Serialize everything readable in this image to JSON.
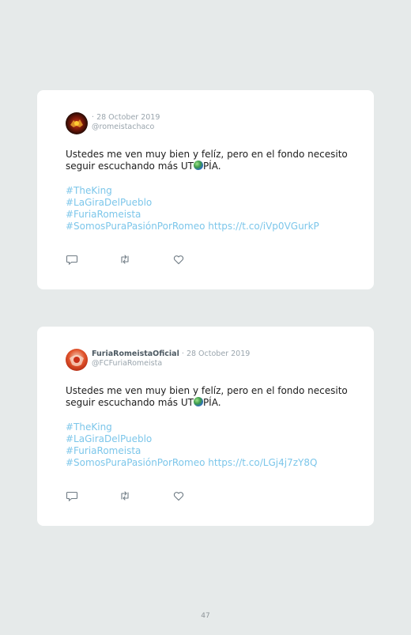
{
  "tweets": [
    {
      "display_name": "",
      "separator": "·",
      "date": "28 October 2019",
      "handle": "@romeistachaco",
      "text_line1": "Ustedes me ven muy bien y felíz, pero en el fondo necesito",
      "text_line2_a": "seguir escuchando más UT",
      "text_line2_b": "PÍA.",
      "hashtags": [
        "#TheKing",
        "#LaGiraDelPueblo",
        "#FuriaRomeista"
      ],
      "last_line": "#SomosPuraPasiónPorRomeo https://t.co/iVp0VGurkP",
      "avatar_color": "#7a1a0c"
    },
    {
      "display_name": "FuriaRomeistaOficial",
      "separator": "·",
      "date": "28 October 2019",
      "handle": "@FCFuriaRomeista",
      "text_line1": "Ustedes me ven muy bien y felíz, pero en el fondo necesito",
      "text_line2_a": "seguir escuchando más UT",
      "text_line2_b": "PÍA.",
      "hashtags": [
        "#TheKing",
        "#LaGiraDelPueblo",
        "#FuriaRomeista"
      ],
      "last_line": "#SomosPuraPasiónPorRomeo https://t.co/LGj4j7zY8Q",
      "avatar_color": "#e2552d"
    }
  ],
  "icons": {
    "reply": "reply-icon",
    "retweet": "retweet-icon",
    "like": "heart-icon",
    "globe": "globe-emoji-icon"
  },
  "colors": {
    "background": "#e6eaea",
    "card": "#ffffff",
    "link": "#7cc6ea",
    "meta": "#9aa5ad"
  },
  "page_number": "47"
}
